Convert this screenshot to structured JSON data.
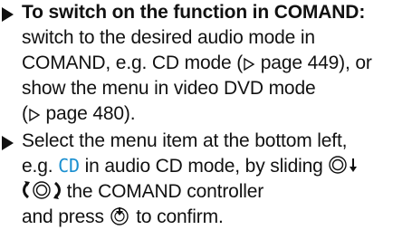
{
  "step1": {
    "lead": "To switch on the function in COMAND:",
    "lines": [
      "switch to the desired audio mode in",
      "COMAND, e.g. CD mode (",
      " page 449), or",
      "show the menu in video DVD mode",
      "(",
      " page 480)."
    ]
  },
  "step2": {
    "line1": "Select the menu item at the bottom left,",
    "line2_pre": "e.g. ",
    "cd": "CD",
    "line2_post": " in audio CD mode, by sliding",
    "line3_post": " the COMAND controller",
    "line4_pre": "and press",
    "line4_post": " to confirm."
  },
  "icons": {
    "bullet": "triangle-bullet-icon",
    "page_ref": "page-reference-triangle-icon",
    "slide_down": "controller-slide-down-icon",
    "turn": "controller-turn-icon",
    "press": "controller-press-icon"
  },
  "colors": {
    "text": "#111111",
    "accent": "#1a8fd0"
  }
}
